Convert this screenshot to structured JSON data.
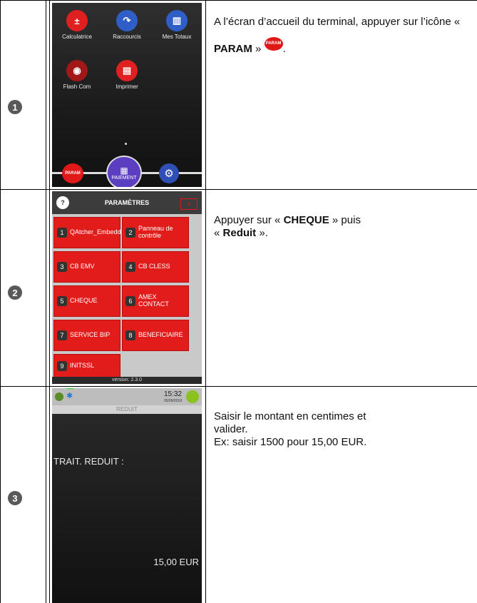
{
  "steps": [
    {
      "number": "1",
      "text_before": "A l’écran d’accueil du terminal, appuyer sur l’icône « ",
      "bold": "PARAM",
      "text_after": " » ",
      "inline_icon": "PARAM",
      "end": ".",
      "screen": {
        "apps": [
          {
            "label": "Calculatrice",
            "icon": "calculator-icon",
            "color": "#e02020",
            "glyph": "+-"
          },
          {
            "label": "Raccourcis",
            "icon": "shortcut-arrow-icon",
            "color": "#2f5fc6",
            "glyph": "↷"
          },
          {
            "label": "Mes Totaux",
            "icon": "totals-chart-icon",
            "color": "#2f5fc6",
            "glyph": "▥"
          },
          {
            "label": "Flash Com",
            "icon": "flash-com-icon",
            "color": "#a01818",
            "glyph": "◉"
          },
          {
            "label": "Imprimer",
            "icon": "printer-icon",
            "color": "#e02020",
            "glyph": "▤"
          }
        ],
        "dock": {
          "param": "PARAM",
          "pay": "PAIEMENT"
        }
      }
    },
    {
      "number": "2",
      "line1_before": "Appuyer sur « ",
      "line1_bold": "CHEQUE",
      "line1_after": " » puis",
      "line2_before": "« ",
      "line2_bold": "Reduit",
      "line2_after": " ».",
      "screen": {
        "title": "PARAMÈTRES",
        "help": "?",
        "close": "×",
        "buttons": [
          {
            "n": "1",
            "label": "QAtcher_Embedd"
          },
          {
            "n": "2",
            "label": "Panneau de contrôle"
          },
          {
            "n": "3",
            "label": "CB EMV"
          },
          {
            "n": "4",
            "label": "CB CLESS"
          },
          {
            "n": "5",
            "label": "CHEQUE"
          },
          {
            "n": "6",
            "label": "AMEX CONTACT"
          },
          {
            "n": "7",
            "label": "SERVICE BIP"
          },
          {
            "n": "8",
            "label": "BENEFICIAIRE"
          },
          {
            "n": "9",
            "label": "INITSSL"
          }
        ],
        "version": "version: 2.3.0"
      }
    },
    {
      "number": "3",
      "line1": "Saisir le montant en centimes et",
      "line2": "valider.",
      "line3": "Ex: saisir 1500 pour 15,00 EUR.",
      "screen": {
        "time": "15:32",
        "date": "05/09/2018",
        "title": "REDUIT",
        "label": "TRAIT. REDUIT :",
        "amount": "15,00 EUR"
      }
    }
  ]
}
